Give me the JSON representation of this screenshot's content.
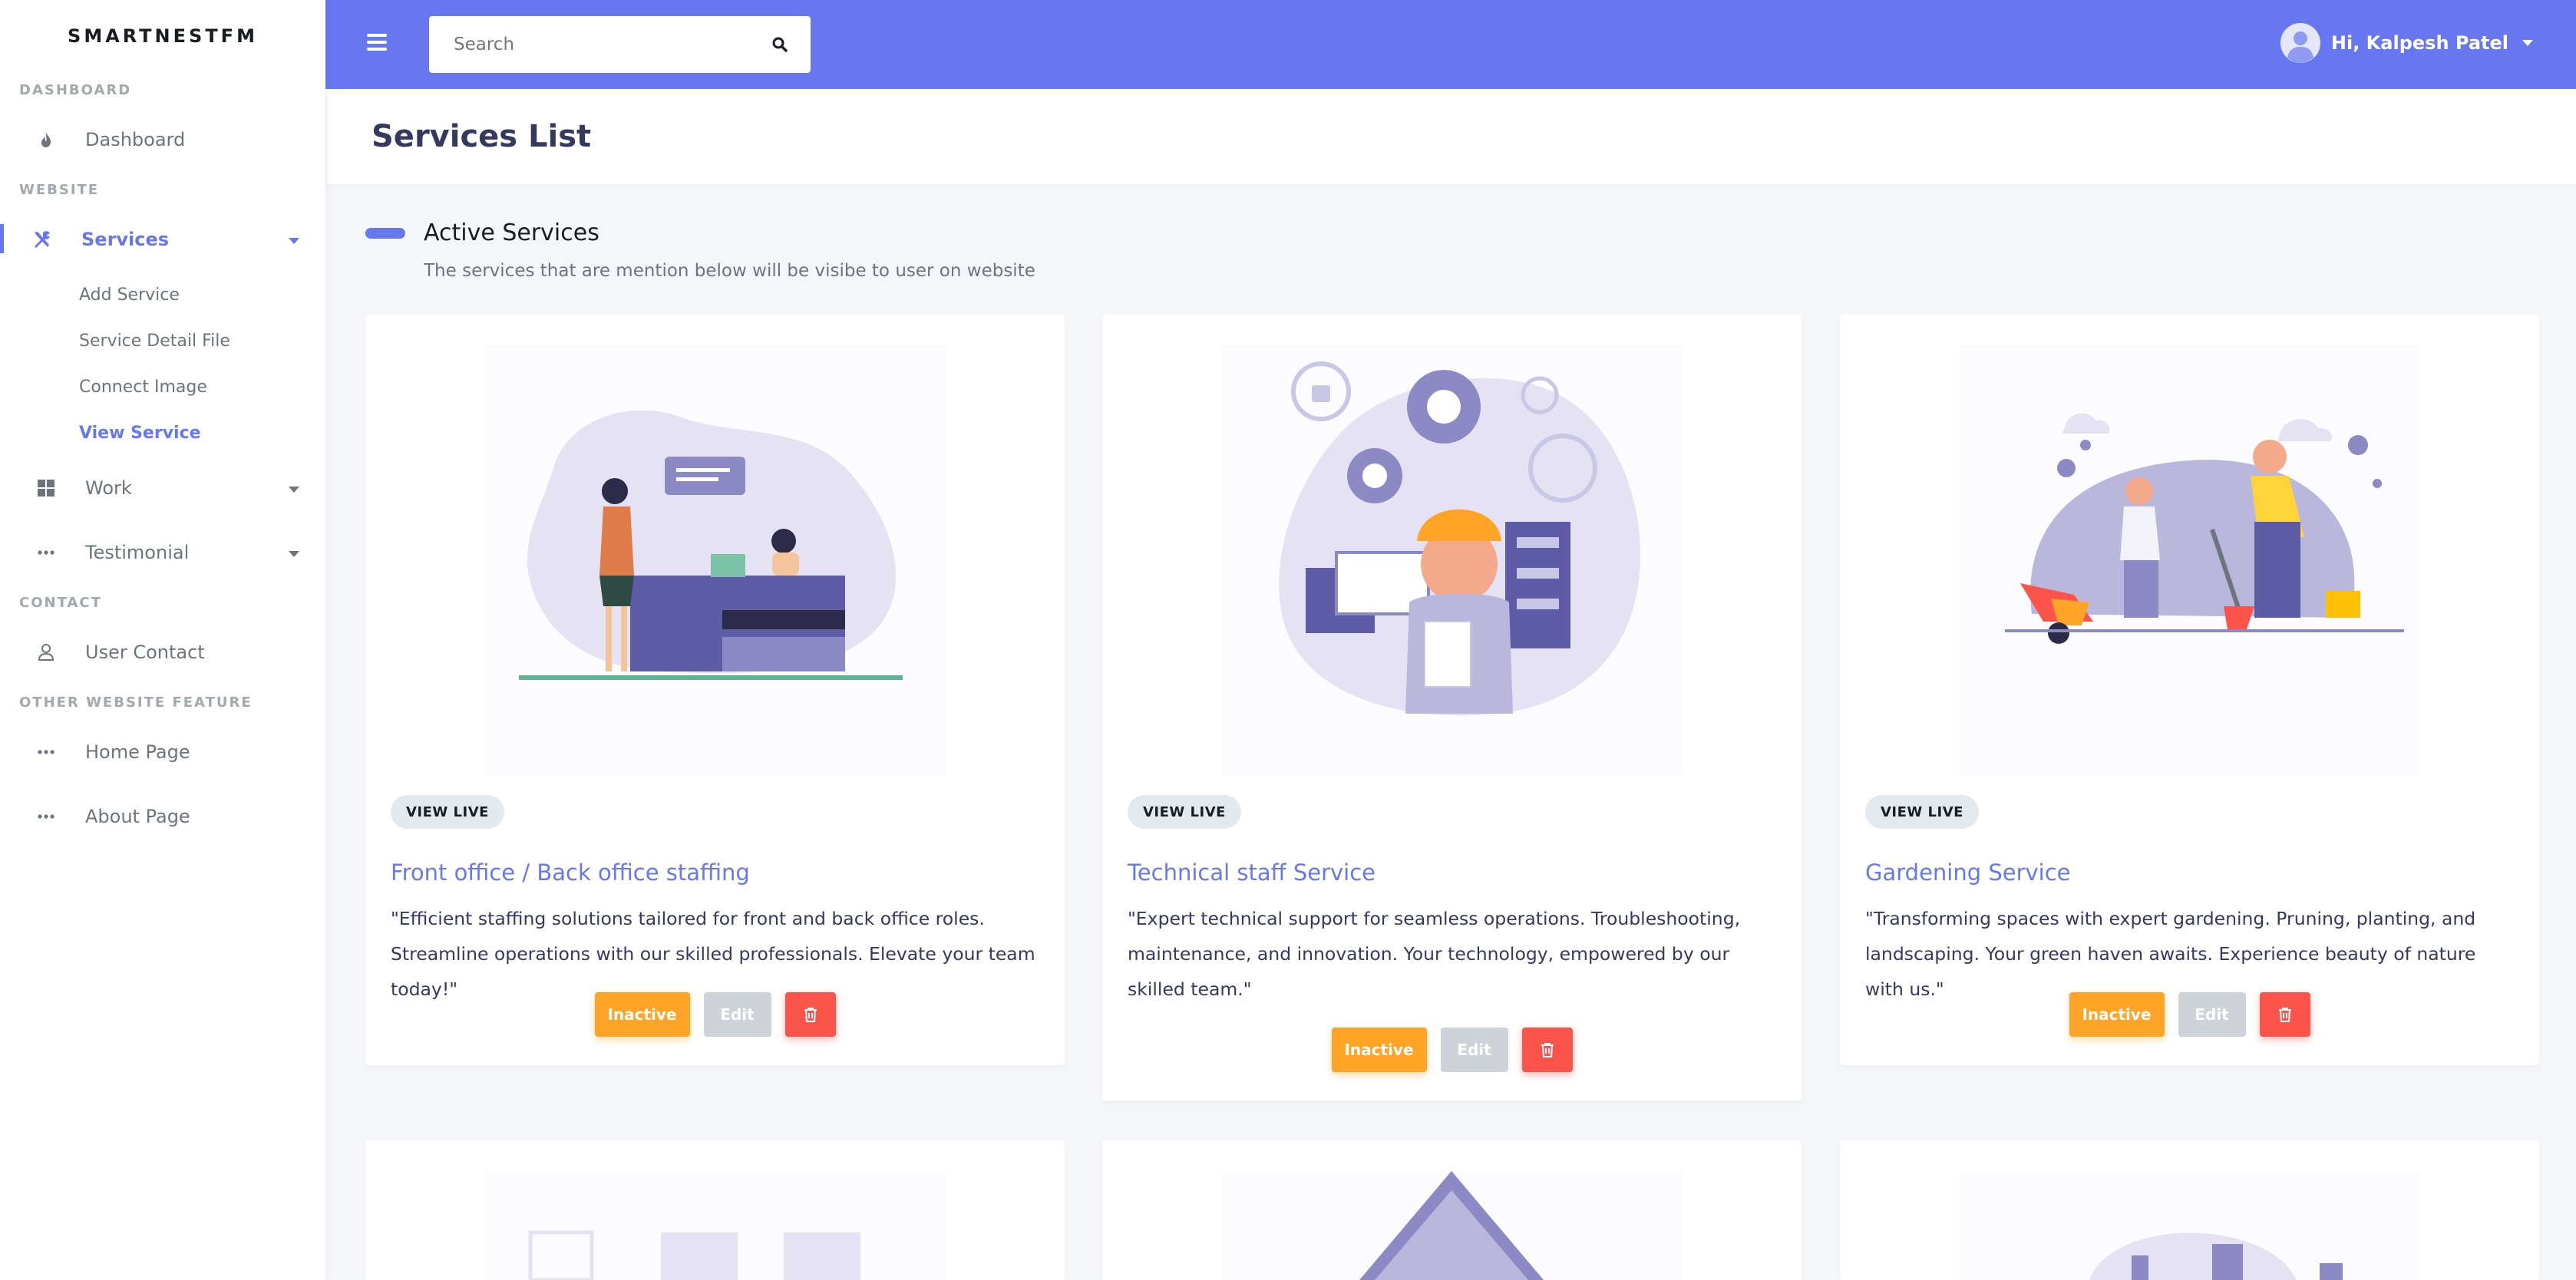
{
  "brand": "SMARTNESTFM",
  "sidebar": {
    "header_dashboard": "DASHBOARD",
    "dashboard": "Dashboard",
    "header_website": "WEBSITE",
    "services": "Services",
    "services_sub": {
      "add": "Add Service",
      "detail": "Service Detail File",
      "connect": "Connect Image",
      "view": "View Service"
    },
    "work": "Work",
    "testimonial": "Testimonial",
    "header_contact": "CONTACT",
    "user_contact": "User Contact",
    "header_other": "OTHER WEBSITE FEATURE",
    "home_page": "Home Page",
    "about_page": "About Page"
  },
  "navbar": {
    "search_placeholder": "Search",
    "user_greeting": "Hi, Kalpesh Patel"
  },
  "page": {
    "title": "Services List",
    "section_title": "Active Services",
    "section_lead": "The services that are mention below will be visibe to user on website"
  },
  "cards": [
    {
      "badge": "VIEW LIVE",
      "title": "Front office / Back office staffing",
      "desc": "\"Efficient staffing solutions tailored for front and back office roles. Streamline operations with our skilled professionals. Elevate your team today!\"",
      "btn_status": "Inactive",
      "btn_edit": "Edit"
    },
    {
      "badge": "VIEW LIVE",
      "title": "Technical staff Service",
      "desc": "\"Expert technical support for seamless operations. Troubleshooting, maintenance, and innovation. Your technology, empowered by our skilled team.\"",
      "btn_status": "Inactive",
      "btn_edit": "Edit"
    },
    {
      "badge": "VIEW LIVE",
      "title": "Gardening Service",
      "desc": "\"Transforming spaces with expert gardening. Pruning, planting, and landscaping. Your green haven awaits. Experience beauty of nature with us.\"",
      "btn_status": "Inactive",
      "btn_edit": "Edit"
    }
  ],
  "colors": {
    "primary": "#6777ef",
    "warning": "#ffa426",
    "danger": "#fc544b",
    "secondary": "#cdd3d8"
  },
  "icons": [
    "fire-icon",
    "tools-icon",
    "grid-icon",
    "dots-icon",
    "user-icon",
    "search-icon",
    "menu-icon",
    "trash-icon"
  ]
}
